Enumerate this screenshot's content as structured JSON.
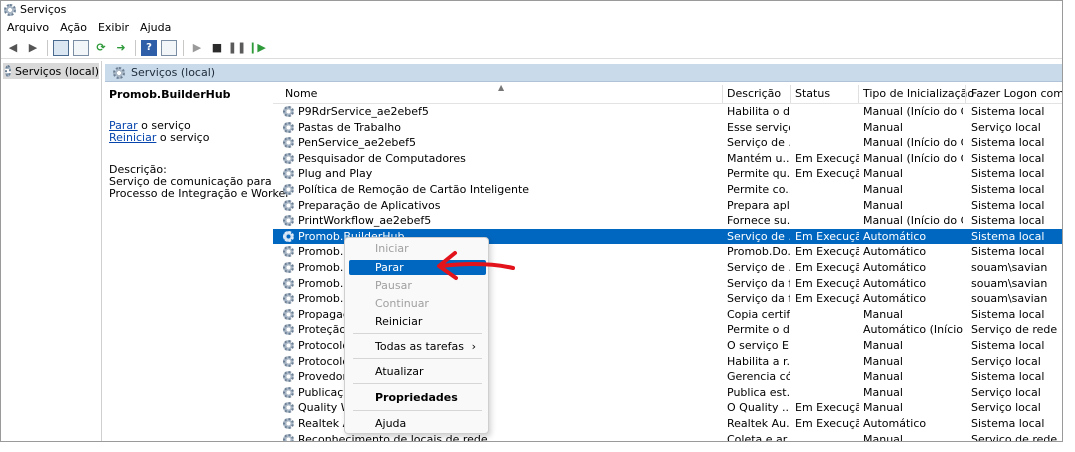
{
  "window": {
    "title": "Serviços"
  },
  "menu": [
    "Arquivo",
    "Ação",
    "Exibir",
    "Ajuda"
  ],
  "tree": {
    "item": "Serviços (local)"
  },
  "pane_header": "Serviços (local)",
  "detail": {
    "service_name": "Promob.BuilderHub",
    "stop_link": "Parar",
    "stop_suffix": " o serviço",
    "restart_link": "Reiniciar",
    "restart_suffix": " o serviço",
    "description_label": "Descrição:",
    "description_line1": "Serviço de comunicação para",
    "description_line2": "Processo de Integração e Worker"
  },
  "columns": {
    "name": "Nome",
    "description": "Descrição",
    "status": "Status",
    "startup": "Tipo de Inicialização",
    "logon": "Fazer Logon como"
  },
  "rows": [
    {
      "name": "P9RdrService_ae2ebef5",
      "description": "Habilita o d...",
      "status": "",
      "startup": "Manual (Início do Ga...",
      "logon": "Sistema local"
    },
    {
      "name": "Pastas de Trabalho",
      "description": "Esse serviço...",
      "status": "",
      "startup": "Manual",
      "logon": "Serviço local"
    },
    {
      "name": "PenService_ae2ebef5",
      "description": "Serviço de ...",
      "status": "",
      "startup": "Manual (Início do Ga...",
      "logon": "Sistema local"
    },
    {
      "name": "Pesquisador de Computadores",
      "description": "Mantém u...",
      "status": "Em Execução",
      "startup": "Manual (Início do Ga...",
      "logon": "Sistema local"
    },
    {
      "name": "Plug and Play",
      "description": "Permite qu...",
      "status": "Em Execução",
      "startup": "Manual",
      "logon": "Sistema local"
    },
    {
      "name": "Política de Remoção de Cartão Inteligente",
      "description": "Permite co...",
      "status": "",
      "startup": "Manual",
      "logon": "Sistema local"
    },
    {
      "name": "Preparação de Aplicativos",
      "description": "Prepara apli...",
      "status": "",
      "startup": "Manual",
      "logon": "Sistema local"
    },
    {
      "name": "PrintWorkflow_ae2ebef5",
      "description": "Fornece su...",
      "status": "",
      "startup": "Manual (Início do Ga...",
      "logon": "Sistema local"
    },
    {
      "name": "Promob.BuilderHub",
      "description": "Serviço de ...",
      "status": "Em Execução",
      "startup": "Automático",
      "logon": "Sistema local",
      "selected": true
    },
    {
      "name": "Promob.D",
      "description": "Promob.Do...",
      "status": "Em Execução",
      "startup": "Automático",
      "logon": "Sistema local"
    },
    {
      "name": "Promob.L",
      "description": "Serviço de ...",
      "status": "Em Execução",
      "startup": "Automático",
      "logon": "souam\\savian"
    },
    {
      "name": "Promob.Q",
      "description": "Serviço da f...",
      "status": "Em Execução",
      "startup": "Automático",
      "logon": "souam\\savian"
    },
    {
      "name": "Promob.Q",
      "description": "Serviço da f...",
      "status": "Em Execução",
      "startup": "Automático",
      "logon": "souam\\savian"
    },
    {
      "name": "Propagaç",
      "description": "Copia certif...",
      "status": "",
      "startup": "Manual",
      "logon": "Sistema local"
    },
    {
      "name": "Proteção d",
      "description": "Permite o d...",
      "status": "",
      "startup": "Automático (Início c...",
      "logon": "Serviço de rede"
    },
    {
      "name": "Protocolo",
      "description": "O serviço E...",
      "status": "",
      "startup": "Manual",
      "logon": "Sistema local"
    },
    {
      "name": "Protocolo",
      "description": "Habilita a r...",
      "status": "",
      "startup": "Manual",
      "logon": "Serviço local"
    },
    {
      "name": "Provedor d                                                    a Microsoft",
      "description": "Gerencia có...",
      "status": "",
      "startup": "Manual",
      "logon": "Sistema local"
    },
    {
      "name": "Publicaçã                                                     unção",
      "description": "Publica est...",
      "status": "",
      "startup": "Manual",
      "logon": "Serviço local"
    },
    {
      "name": "Quality Wi",
      "description": "O Quality ...",
      "status": "Em Execução",
      "startup": "Manual",
      "logon": "Serviço local"
    },
    {
      "name": "Realtek Au",
      "description": "Realtek Au...",
      "status": "Em Execução",
      "startup": "Automático",
      "logon": "Sistema local"
    },
    {
      "name": "Reconhecimento de locais de rede",
      "description": "Coleta e ar...",
      "status": "",
      "startup": "Manual",
      "logon": "Serviço de rede"
    }
  ],
  "context_menu": {
    "start": "Iniciar",
    "stop": "Parar",
    "pause": "Pausar",
    "resume": "Continuar",
    "restart": "Reiniciar",
    "all_tasks": "Todas as tarefas",
    "all_tasks_arrow": "›",
    "refresh": "Atualizar",
    "properties": "Propriedades",
    "help": "Ajuda"
  },
  "colors": {
    "selection": "#0067c0",
    "annotation_arrow": "#e3131b",
    "pane_header": "#c9daea"
  }
}
